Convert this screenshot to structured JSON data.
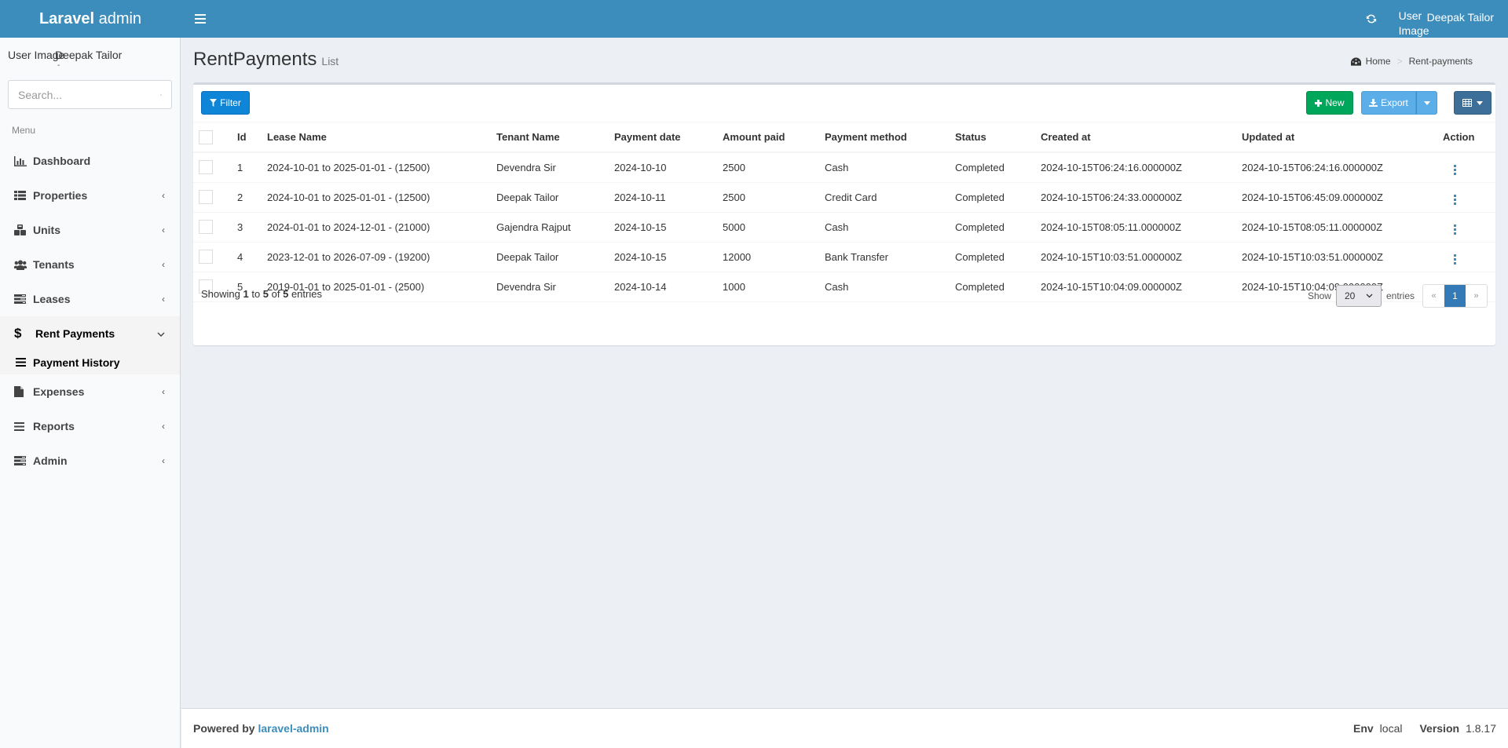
{
  "header": {
    "logo_bold": "Laravel",
    "logo_rest": " admin",
    "user_image_alt": "User Image",
    "user_name": "Deepak Tailor",
    "colors": {
      "header_bg": "#3c8dbc"
    }
  },
  "sidebar": {
    "user_image_alt": "User Image",
    "user_name": "Deepak Tailor",
    "user_status": "-",
    "search_placeholder": "Search...",
    "menu_header": "Menu",
    "items": [
      {
        "label": "Dashboard",
        "icon": "bar-chart-icon",
        "has_children": false
      },
      {
        "label": "Properties",
        "icon": "list-icon",
        "has_children": true
      },
      {
        "label": "Units",
        "icon": "cubes-icon",
        "has_children": true
      },
      {
        "label": "Tenants",
        "icon": "users-icon",
        "has_children": true
      },
      {
        "label": "Leases",
        "icon": "tasks-icon",
        "has_children": true
      },
      {
        "label": "Rent Payments",
        "icon": "dollar-icon",
        "has_children": true,
        "expanded": true
      },
      {
        "label": "Expenses",
        "icon": "file-icon",
        "has_children": true
      },
      {
        "label": "Reports",
        "icon": "bars-icon",
        "has_children": true
      },
      {
        "label": "Admin",
        "icon": "tasks-icon",
        "has_children": true
      }
    ],
    "submenu": [
      {
        "label": "Payment History",
        "icon": "bars-icon"
      }
    ]
  },
  "content": {
    "title": "RentPayments",
    "subtitle": "List",
    "breadcrumb": {
      "home": "Home",
      "current": "Rent-payments"
    }
  },
  "toolbar": {
    "filter_label": "Filter",
    "new_label": "New",
    "export_label": "Export"
  },
  "table": {
    "columns": [
      "Id",
      "Lease Name",
      "Tenant Name",
      "Payment date",
      "Amount paid",
      "Payment method",
      "Status",
      "Created at",
      "Updated at",
      "Action"
    ],
    "rows": [
      {
        "id": "1",
        "lease": "2024-10-01 to 2025-01-01 - (12500)",
        "tenant": "Devendra Sir",
        "date": "2024-10-10",
        "amount": "2500",
        "method": "Cash",
        "status": "Completed",
        "created": "2024-10-15T06:24:16.000000Z",
        "updated": "2024-10-15T06:24:16.000000Z"
      },
      {
        "id": "2",
        "lease": "2024-10-01 to 2025-01-01 - (12500)",
        "tenant": "Deepak Tailor",
        "date": "2024-10-11",
        "amount": "2500",
        "method": "Credit Card",
        "status": "Completed",
        "created": "2024-10-15T06:24:33.000000Z",
        "updated": "2024-10-15T06:45:09.000000Z"
      },
      {
        "id": "3",
        "lease": "2024-01-01 to 2024-12-01 - (21000)",
        "tenant": "Gajendra Rajput",
        "date": "2024-10-15",
        "amount": "5000",
        "method": "Cash",
        "status": "Completed",
        "created": "2024-10-15T08:05:11.000000Z",
        "updated": "2024-10-15T08:05:11.000000Z"
      },
      {
        "id": "4",
        "lease": "2023-12-01 to 2026-07-09 - (19200)",
        "tenant": "Deepak Tailor",
        "date": "2024-10-15",
        "amount": "12000",
        "method": "Bank Transfer",
        "status": "Completed",
        "created": "2024-10-15T10:03:51.000000Z",
        "updated": "2024-10-15T10:03:51.000000Z"
      },
      {
        "id": "5",
        "lease": "2019-01-01 to 2025-01-01 - (2500)",
        "tenant": "Devendra Sir",
        "date": "2024-10-14",
        "amount": "1000",
        "method": "Cash",
        "status": "Completed",
        "created": "2024-10-15T10:04:09.000000Z",
        "updated": "2024-10-15T10:04:09.000000Z"
      }
    ]
  },
  "pagination": {
    "showing_prefix": "Showing ",
    "from": "1",
    "to_word": " to ",
    "to": "5",
    "of_word": " of ",
    "total": "5",
    "suffix": " entries",
    "show_label": "Show",
    "per_page": "20",
    "entries_label": "entries",
    "prev": "«",
    "current_page": "1",
    "next": "»"
  },
  "footer": {
    "powered_by": "Powered by ",
    "link": "laravel-admin",
    "env_label": "Env",
    "env_value": "local",
    "version_label": "Version",
    "version_value": "1.8.17"
  }
}
